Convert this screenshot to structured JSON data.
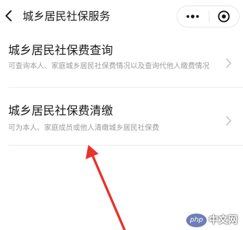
{
  "header": {
    "title": "城乡居民社保服务",
    "back_icon": "back-chevron-icon",
    "more_icon": "more-dots-icon",
    "close_icon": "target-circle-icon"
  },
  "items": [
    {
      "title": "城乡居民社保费查询",
      "description": "可查询本人、家庭城乡居民社保费情况以及查询代他人缴费情况"
    },
    {
      "title": "城乡居民社保费清缴",
      "description": "可为本人、家庭成员或他人清缴城乡居民社保费"
    }
  ],
  "annotation": {
    "arrow_color": "#e8322c"
  },
  "watermark": {
    "logo_text": "php",
    "text": "中文网"
  }
}
